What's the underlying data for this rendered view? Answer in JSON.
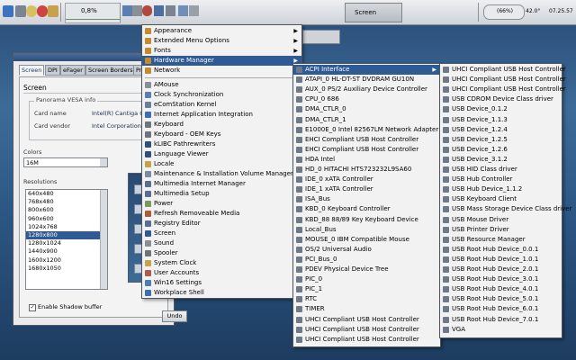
{
  "taskbar": {
    "cpu_percent": "0,8%",
    "screen_task_label": "Screen",
    "battery": "(66%)",
    "temperature": "42.0°",
    "clock": "07.25.57"
  },
  "dialog": {
    "tabs": [
      "Screen",
      "DPI",
      "eFager",
      "Screen Borders",
      "Pri"
    ],
    "panel_heading": "Screen",
    "vesa_title": "Panorama VESA info",
    "card_name_label": "Card name",
    "card_name_value": "Intel(R) Cantiga G",
    "card_vendor_label": "Card vendor",
    "card_vendor_value": "Intel Corporation",
    "colors_label": "Colors",
    "colors_value": "16M",
    "resolutions_label": "Resolutions",
    "resolutions": [
      "640x480",
      "768x480",
      "800x600",
      "960x600",
      "1024x768",
      "1280x800",
      "1280x1024",
      "1440x900",
      "1600x1200",
      "1680x1050"
    ],
    "selected_resolution_index": 5,
    "shadow_checked": true,
    "shadow_label": "Enable Shadow buffer",
    "undo_label": "Undo"
  },
  "main_menu": {
    "items": [
      {
        "label": "Appearance",
        "submenu": true,
        "icon_color": "#c68a2e"
      },
      {
        "label": "Extended Menu Options",
        "submenu": true,
        "icon_color": "#c68a2e"
      },
      {
        "label": "Fonts",
        "submenu": true,
        "icon_color": "#c68a2e"
      },
      {
        "label": "Hardware Manager",
        "submenu": true,
        "icon_color": "#c68a2e",
        "highlighted": true
      },
      {
        "label": "Network",
        "submenu": true,
        "icon_color": "#c68a2e"
      },
      {
        "label": "AMouse",
        "icon_color": "#8a8f96"
      },
      {
        "label": "Clock Synchronization",
        "icon_color": "#5b7fb0"
      },
      {
        "label": "eComStation Kernel",
        "icon_color": "#6b7f9a"
      },
      {
        "label": "Internet Application Integration",
        "icon_color": "#3a6fb5"
      },
      {
        "label": "Keyboard",
        "icon_color": "#6f737a"
      },
      {
        "label": "Keyboard - OEM Keys",
        "icon_color": "#6f737a"
      },
      {
        "label": "kLIBC Pathrewriters",
        "icon_color": "#2f4f7a"
      },
      {
        "label": "Language Viewer",
        "icon_color": "#2f4f7a"
      },
      {
        "label": "Locale",
        "icon_color": "#c8a24a"
      },
      {
        "label": "Maintenance & Installation Volume Manager",
        "icon_color": "#7d8a9a"
      },
      {
        "label": "Multimedia Internet Manager",
        "icon_color": "#5a6f8f"
      },
      {
        "label": "Multimedia Setup",
        "icon_color": "#5a6f8f"
      },
      {
        "label": "Power",
        "icon_color": "#7a9a5a"
      },
      {
        "label": "Refresh Removeable Media",
        "icon_color": "#b05a3a"
      },
      {
        "label": "Registry Editor",
        "icon_color": "#5a6f8f"
      },
      {
        "label": "Screen",
        "icon_color": "#2f5a93"
      },
      {
        "label": "Sound",
        "icon_color": "#8a8f96"
      },
      {
        "label": "Spooler",
        "icon_color": "#6f737a"
      },
      {
        "label": "System Clock",
        "icon_color": "#c8a24a"
      },
      {
        "label": "User Accounts",
        "icon_color": "#b0584a"
      },
      {
        "label": "Win16 Settings",
        "icon_color": "#4a7fb0"
      },
      {
        "label": "Workplace Shell",
        "icon_color": "#3a6fb5"
      }
    ]
  },
  "hardware_menu": {
    "items": [
      {
        "label": "ACPI Interface",
        "submenu": true,
        "highlighted": true
      },
      {
        "label": "ATAPI_0 HL-DT-ST DVDRAM GU10N"
      },
      {
        "label": "AUX_0 PS/2 Auxiliary Device Controller"
      },
      {
        "label": "CPU_0 686"
      },
      {
        "label": "DMA_CTLR_0"
      },
      {
        "label": "DMA_CTLR_1"
      },
      {
        "label": "E1000E_0 Intel 82567LM Network Adapter"
      },
      {
        "label": "EHCI Compliant USB Host Controller"
      },
      {
        "label": "EHCI Compliant USB Host Controller"
      },
      {
        "label": "HDA Intel"
      },
      {
        "label": "HD_0 HITACHI HTS723232L9SA60"
      },
      {
        "label": "IDE_0 xATA Controller"
      },
      {
        "label": "IDE_1 xATA Controller"
      },
      {
        "label": "ISA_Bus"
      },
      {
        "label": "KBD_0 Keyboard Controller"
      },
      {
        "label": "KBD_88 88/89 Key Keyboard Device"
      },
      {
        "label": "Local_Bus"
      },
      {
        "label": "MOUSE_0 IBM Compatible Mouse"
      },
      {
        "label": "OS/2 Universal Audio"
      },
      {
        "label": "PCI_Bus_0"
      },
      {
        "label": "PDEV Physical Device Tree"
      },
      {
        "label": "PIC_0"
      },
      {
        "label": "PIC_1"
      },
      {
        "label": "RTC"
      },
      {
        "label": "TIMER"
      },
      {
        "label": "UHCI Compliant USB Host Controller"
      },
      {
        "label": "UHCI Compliant USB Host Controller"
      },
      {
        "label": "UHCI Compliant USB Host Controller"
      }
    ]
  },
  "usb_menu": {
    "items": [
      "UHCI Compliant USB Host Controller",
      "UHCI Compliant USB Host Controller",
      "UHCI Compliant USB Host Controller",
      "USB CDROM Device Class driver",
      "USB Device_0.1.2",
      "USB Device_1.1.3",
      "USB Device_1.2.4",
      "USB Device_1.2.5",
      "USB Device_1.2.6",
      "USB Device_3.1.2",
      "USB HID Class driver",
      "USB Hub Controller",
      "USB Hub Device_1.1.2",
      "USB Keyboard Client",
      "USB Mass Storage Device Class driver",
      "USB Mouse Driver",
      "USB Printer Driver",
      "USB Resource Manager",
      "USB Root Hub Device_0.0.1",
      "USB Root Hub Device_1.0.1",
      "USB Root Hub Device_2.0.1",
      "USB Root Hub Device_3.0.1",
      "USB Root Hub Device_4.0.1",
      "USB Root Hub Device_5.0.1",
      "USB Root Hub Device_6.0.1",
      "USB Root Hub Device_7.0.1",
      "VGA"
    ]
  }
}
